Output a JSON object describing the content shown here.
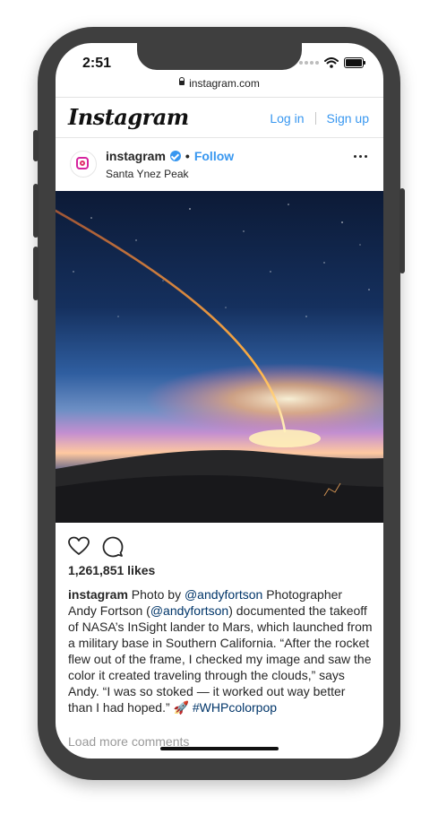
{
  "status_bar": {
    "time": "2:51"
  },
  "browser": {
    "url": "instagram.com"
  },
  "header": {
    "logo": "Instagram",
    "login": "Log in",
    "signup": "Sign up"
  },
  "post": {
    "username": "instagram",
    "bullet": "•",
    "follow": "Follow",
    "location": "Santa Ynez Peak",
    "likes": "1,261,851 likes",
    "caption": {
      "user": "instagram",
      "text1": " Photo by ",
      "mention1": "@andyfortson",
      "text2": " Photographer Andy Fortson (",
      "mention2": "@andyfortson",
      "text3": ") documented the takeoff of NASA’s InSight lander to Mars, which launched from a military base in Southern California. “After the rocket flew out of the frame, I checked my image and saw the color it created traveling through the clouds,” says Andy. “I was so stoked — it worked out way better than I had hoped.” ",
      "emoji": "🚀",
      "hashtag": " #WHPcolorpop"
    },
    "load_more": "Load more comments"
  },
  "colors": {
    "accent": "#3897f0",
    "link": "#003569",
    "frame": "#3f3f3f"
  },
  "icons": [
    "lock-icon",
    "wifi-icon",
    "battery-icon",
    "verified-icon",
    "more-options-icon",
    "heart-icon",
    "comment-icon"
  ]
}
